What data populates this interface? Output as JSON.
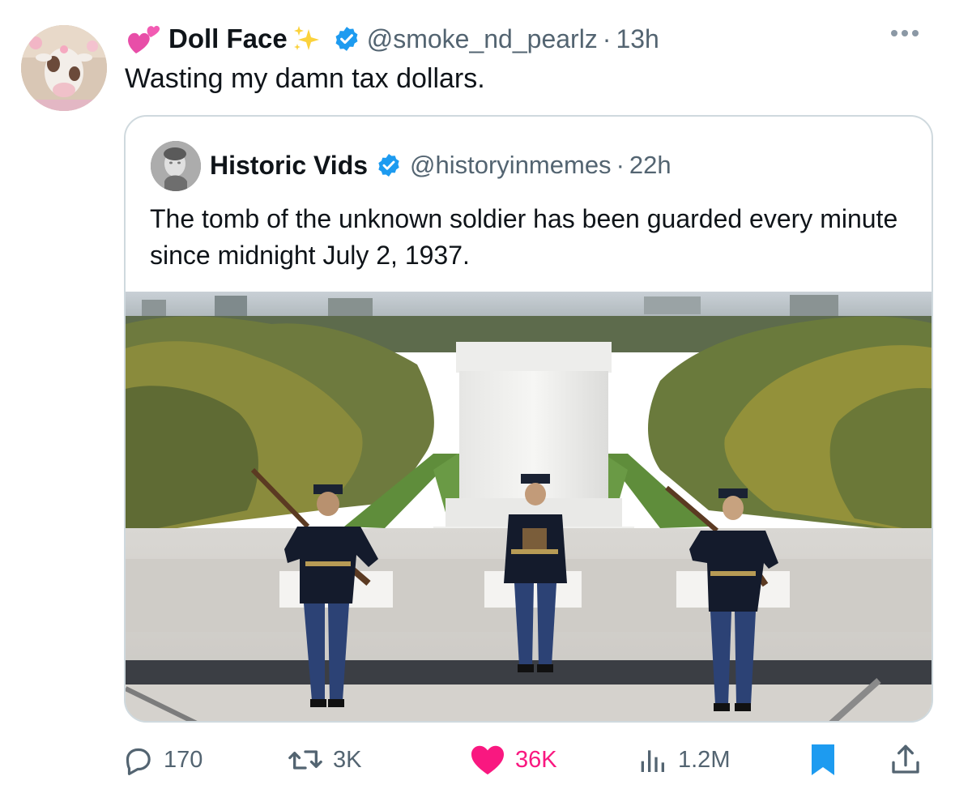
{
  "post": {
    "author_name": "Doll Face",
    "handle": "@smoke_nd_pearlz",
    "separator": "·",
    "time": "13h",
    "text": "Wasting my damn tax dollars."
  },
  "quote": {
    "author_name": "Historic Vids",
    "handle": "@historyinmemes",
    "separator": "·",
    "time": "22h",
    "text": "The tomb of the unknown soldier has been guarded every minute since midnight July 2, 1937."
  },
  "actions": {
    "replies": "170",
    "reposts": "3K",
    "likes": "36K",
    "views": "1.2M"
  },
  "colors": {
    "verified": "#1d9bf0",
    "like": "#f91880",
    "bookmark": "#1d9bf0",
    "secondary_text": "#536471"
  }
}
